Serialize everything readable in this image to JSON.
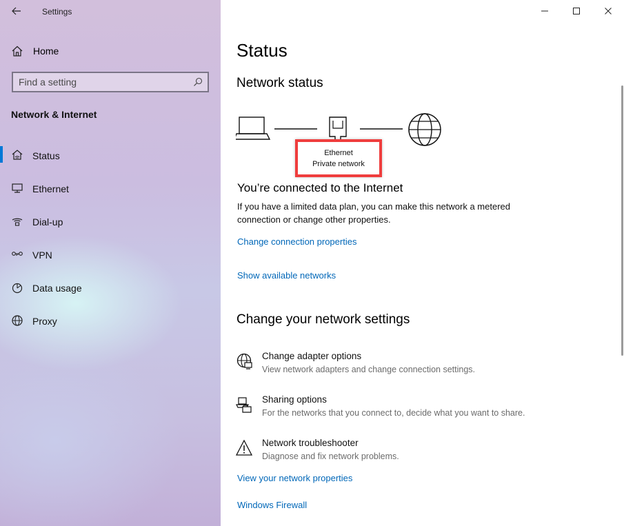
{
  "window": {
    "title": "Settings"
  },
  "sidebar": {
    "home_label": "Home",
    "search_placeholder": "Find a setting",
    "section_title": "Network & Internet",
    "items": [
      {
        "label": "Status",
        "icon": "home-network-icon",
        "active": true
      },
      {
        "label": "Ethernet",
        "icon": "monitor-icon",
        "active": false
      },
      {
        "label": "Dial-up",
        "icon": "phone-icon",
        "active": false
      },
      {
        "label": "VPN",
        "icon": "vpn-icon",
        "active": false
      },
      {
        "label": "Data usage",
        "icon": "data-usage-icon",
        "active": false
      },
      {
        "label": "Proxy",
        "icon": "globe-icon",
        "active": false
      }
    ]
  },
  "main": {
    "title": "Status",
    "network_status_heading": "Network status",
    "tooltip": {
      "line1": "Ethernet",
      "line2": "Private network"
    },
    "connected_heading": "You’re connected to the Internet",
    "connected_desc": "If you have a limited data plan, you can make this network a metered connection or change other properties.",
    "change_connection_link": "Change connection properties",
    "show_networks_link": "Show available networks",
    "change_settings_heading": "Change your network settings",
    "options": [
      {
        "title": "Change adapter options",
        "desc": "View network adapters and change connection settings.",
        "icon": "adapter-icon"
      },
      {
        "title": "Sharing options",
        "desc": "For the networks that you connect to, decide what you want to share.",
        "icon": "sharing-icon"
      },
      {
        "title": "Network troubleshooter",
        "desc": "Diagnose and fix network problems.",
        "icon": "warning-icon"
      }
    ],
    "view_properties_link": "View your network properties",
    "firewall_link": "Windows Firewall"
  },
  "colors": {
    "accent": "#0078d7",
    "link": "#0067b8",
    "highlight": "#ef3d3d"
  }
}
